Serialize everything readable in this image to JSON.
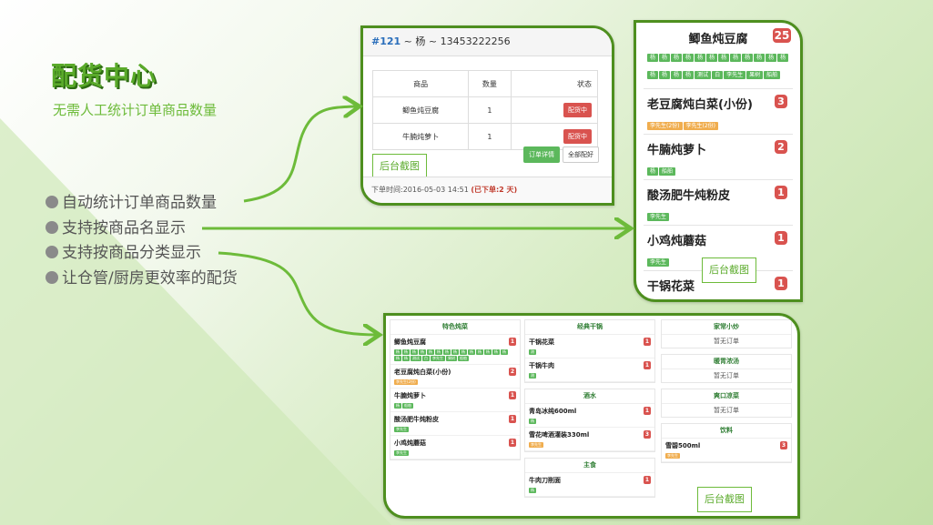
{
  "colors": {
    "brand_green": "#5aaa2a",
    "panel_border": "#4e8f1f",
    "badge_red": "#d9534f",
    "tag_green": "#5cb85c",
    "tag_orange": "#f0ad4e",
    "arrow": "#6dbb3a"
  },
  "title": "配货中心",
  "subtitle": "无需人工统计订单商品数量",
  "features": [
    "自动统计订单商品数量",
    "支持按商品名显示",
    "支持按商品分类显示",
    "让仓管/厨房更效率的配货"
  ],
  "screenshot_label": "后台截图",
  "order_panel": {
    "order_id": "#121",
    "customer": " ~ 杨 ~ 13453222256",
    "columns": [
      "商品",
      "数量",
      "状态"
    ],
    "rows": [
      {
        "product": "鲫鱼炖豆腐",
        "qty": "1",
        "status": "配货中"
      },
      {
        "product": "牛腩炖萝卜",
        "qty": "1",
        "status": "配货中"
      }
    ],
    "detail_button": "订单详情",
    "all_button": "全部配好",
    "time_text": "下单时间:2016-05-03 14:51 ",
    "late_text": "(已下单:2 天)"
  },
  "product_panel": {
    "items": [
      {
        "name": "鲫鱼炖豆腐",
        "count": "25",
        "tags": [
          "杨",
          "杨",
          "杨",
          "杨",
          "杨",
          "杨",
          "杨",
          "杨",
          "杨",
          "杨",
          "杨",
          "杨",
          "杨",
          "杨",
          "杨",
          "杨",
          "测试",
          "白",
          "李先生",
          "果树",
          "船舶"
        ],
        "tag_colors": [
          "g",
          "g",
          "g",
          "g",
          "g",
          "g",
          "g",
          "g",
          "g",
          "g",
          "g",
          "g",
          "g",
          "g",
          "g",
          "g",
          "g",
          "g",
          "g",
          "g",
          "g"
        ]
      },
      {
        "name": "老豆腐炖白菜(小份)",
        "count": "3",
        "tags": [
          "李先生(2份)",
          "李先生(2份)"
        ],
        "tag_colors": [
          "o",
          "o"
        ]
      },
      {
        "name": "牛腩炖萝卜",
        "count": "2",
        "tags": [
          "杨",
          "船舶"
        ],
        "tag_colors": [
          "g",
          "g"
        ]
      },
      {
        "name": "酸汤肥牛炖粉皮",
        "count": "1",
        "tags": [
          "李先生"
        ],
        "tag_colors": [
          "g"
        ]
      },
      {
        "name": "小鸡炖蘑菇",
        "count": "1",
        "tags": [
          "李先生"
        ],
        "tag_colors": [
          "g"
        ]
      },
      {
        "name": "干锅花菜",
        "count": "1",
        "tags": [],
        "tag_colors": []
      }
    ]
  },
  "category_panel": {
    "columns": [
      {
        "sections": [
          {
            "title": "特色炖菜",
            "items": [
              {
                "name": "鲫鱼炖豆腐",
                "count": "1",
                "tags": [
                  "杨",
                  "杨",
                  "杨",
                  "杨",
                  "杨",
                  "杨",
                  "杨",
                  "杨",
                  "杨",
                  "杨",
                  "杨",
                  "杨",
                  "杨",
                  "杨",
                  "杨",
                  "杨",
                  "测试",
                  "白",
                  "李先生",
                  "果树",
                  "船舶"
                ],
                "tag_colors": [
                  "g",
                  "g",
                  "g",
                  "g",
                  "g",
                  "g",
                  "g",
                  "g",
                  "g",
                  "g",
                  "g",
                  "g",
                  "g",
                  "g",
                  "g",
                  "g",
                  "g",
                  "g",
                  "g",
                  "g",
                  "g"
                ]
              },
              {
                "name": "老豆腐炖白菜(小份)",
                "count": "2",
                "tags": [
                  "李先生(2份)"
                ],
                "tag_colors": [
                  "o"
                ]
              },
              {
                "name": "牛腩炖萝卜",
                "count": "1",
                "tags": [
                  "杨",
                  "船舶"
                ],
                "tag_colors": [
                  "g",
                  "g"
                ]
              },
              {
                "name": "酸汤肥牛炖粉皮",
                "count": "1",
                "tags": [
                  "李先生"
                ],
                "tag_colors": [
                  "g"
                ]
              },
              {
                "name": "小鸡炖蘑菇",
                "count": "1",
                "tags": [
                  "李先生"
                ],
                "tag_colors": [
                  "g"
                ]
              }
            ]
          }
        ]
      },
      {
        "sections": [
          {
            "title": "经典干锅",
            "items": [
              {
                "name": "干锅花菜",
                "count": "1",
                "tags": [
                  "测"
                ],
                "tag_colors": [
                  "g"
                ]
              },
              {
                "name": "干锅牛肉",
                "count": "1",
                "tags": [
                  "测"
                ],
                "tag_colors": [
                  "g"
                ]
              }
            ]
          },
          {
            "title": "酒水",
            "items": [
              {
                "name": "青岛冰纯600ml",
                "count": "1",
                "tags": [
                  "杨"
                ],
                "tag_colors": [
                  "g"
                ]
              },
              {
                "name": "雪花啤酒灌装330ml",
                "count": "3",
                "tags": [
                  "李先生"
                ],
                "tag_colors": [
                  "o"
                ]
              }
            ]
          },
          {
            "title": "主食",
            "items": [
              {
                "name": "牛肉刀削面",
                "count": "1",
                "tags": [
                  "杨"
                ],
                "tag_colors": [
                  "g"
                ]
              }
            ]
          }
        ]
      },
      {
        "sections": [
          {
            "title": "家常小炒",
            "empty": "暂无订单",
            "items": []
          },
          {
            "title": "暖胃浓汤",
            "empty": "暂无订单",
            "items": []
          },
          {
            "title": "爽口凉菜",
            "empty": "暂无订单",
            "items": []
          },
          {
            "title": "饮料",
            "items": [
              {
                "name": "雪碧500ml",
                "count": "3",
                "tags": [
                  "李先生"
                ],
                "tag_colors": [
                  "o"
                ]
              }
            ]
          }
        ]
      }
    ]
  }
}
